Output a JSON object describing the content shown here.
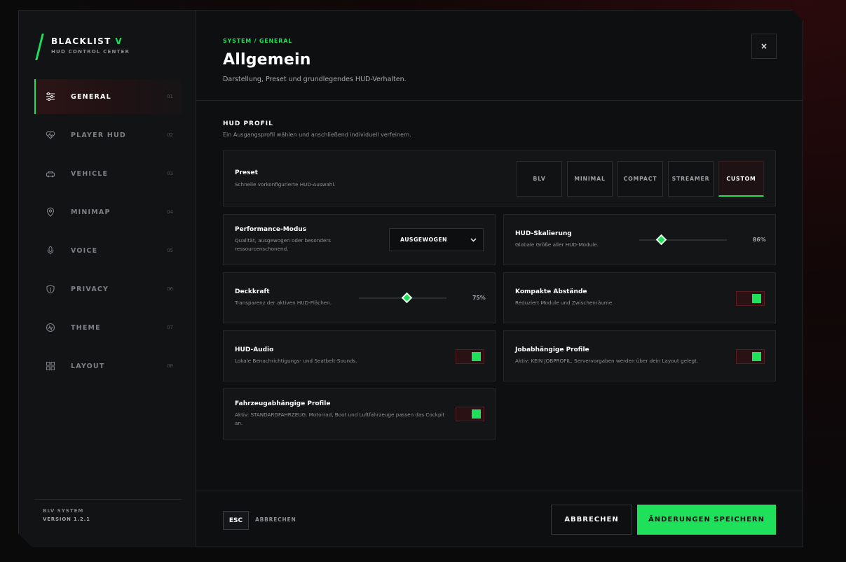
{
  "brand": {
    "name": "BLACKLIST",
    "name_accent": "V",
    "subtitle": "HUD CONTROL CENTER"
  },
  "sidebar": {
    "items": [
      {
        "label": "GENERAL",
        "num": "01",
        "icon": "sliders-icon",
        "active": true
      },
      {
        "label": "PLAYER HUD",
        "num": "02",
        "icon": "heart-pulse-icon",
        "active": false
      },
      {
        "label": "VEHICLE",
        "num": "03",
        "icon": "vehicle-icon",
        "active": false
      },
      {
        "label": "MINIMAP",
        "num": "04",
        "icon": "map-pin-icon",
        "active": false
      },
      {
        "label": "VOICE",
        "num": "05",
        "icon": "microphone-icon",
        "active": false
      },
      {
        "label": "PRIVACY",
        "num": "06",
        "icon": "shield-icon",
        "active": false
      },
      {
        "label": "THEME",
        "num": "07",
        "icon": "palette-icon",
        "active": false
      },
      {
        "label": "LAYOUT",
        "num": "08",
        "icon": "grid-icon",
        "active": false
      }
    ],
    "footer_system": "BLV SYSTEM",
    "footer_version": "VERSION 1.2.1"
  },
  "header": {
    "breadcrumb": "SYSTEM / GENERAL",
    "title": "Allgemein",
    "subtitle": "Darstellung, Preset und grundlegendes HUD-Verhalten.",
    "close_label": "×"
  },
  "section": {
    "title": "HUD PROFIL",
    "subtitle": "Ein Ausgangsprofil wählen und anschließend individuell verfeinern."
  },
  "preset": {
    "title": "Preset",
    "desc": "Schnelle vorkonfigurierte HUD-Auswahl.",
    "options": [
      "BLV",
      "MINIMAL",
      "COMPACT",
      "STREAMER",
      "CUSTOM"
    ],
    "selected": "CUSTOM"
  },
  "performance": {
    "title": "Performance-Modus",
    "desc": "Qualität, ausgewogen oder besonders ressourcenschonend.",
    "value": "AUSGEWOGEN"
  },
  "scaling": {
    "title": "HUD-Skalierung",
    "desc": "Globale Größe aller HUD-Module.",
    "value_label": "86%",
    "fraction": 0.25
  },
  "opacity": {
    "title": "Deckkraft",
    "desc": "Transparenz der aktiven HUD-Flächen.",
    "value_label": "75%",
    "fraction": 0.54
  },
  "compact": {
    "title": "Kompakte Abstände",
    "desc": "Reduziert Module und Zwischenräume.",
    "enabled": true
  },
  "audio": {
    "title": "HUD-Audio",
    "desc": "Lokale Benachrichtigungs- und Seatbelt-Sounds.",
    "enabled": true
  },
  "job_profiles": {
    "title": "Jobabhängige Profile",
    "desc": "Aktiv: KEIN JOBPROFIL. Servervorgaben werden über dein Layout gelegt.",
    "enabled": true
  },
  "vehicle_profiles": {
    "title": "Fahrzeugabhängige Profile",
    "desc": "Aktiv: STANDARDFAHRZEUG. Motorrad, Boot und Luftfahrzeuge passen das Cockpit an.",
    "enabled": true
  },
  "footer": {
    "esc_key": "ESC",
    "esc_label": "ABBRECHEN",
    "cancel_label": "ABBRECHEN",
    "save_label": "ÄNDERUNGEN SPEICHERN"
  },
  "colors": {
    "accent": "#1fe05a",
    "danger_bg": "#2a1113",
    "panel": "#141517"
  }
}
